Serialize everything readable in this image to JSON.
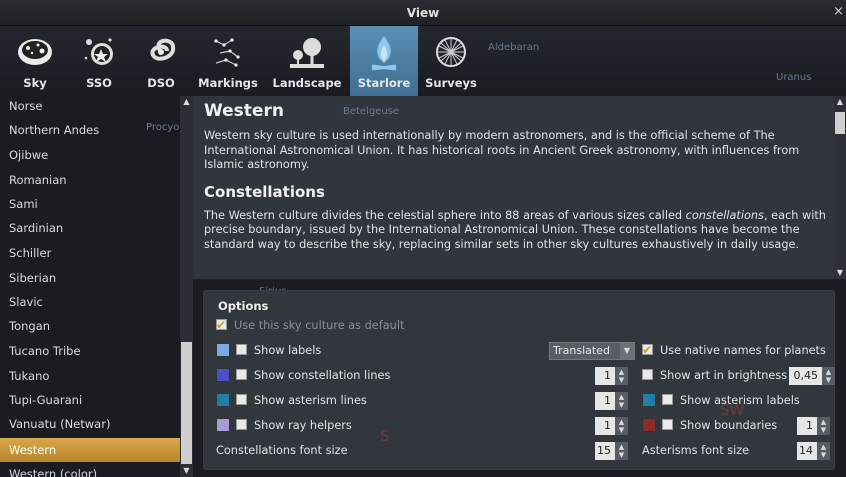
{
  "window": {
    "title": "View",
    "close": "×"
  },
  "toolbar": {
    "tabs": [
      {
        "label": "Sky",
        "icon": "sky-icon"
      },
      {
        "label": "SSO",
        "icon": "sso-icon"
      },
      {
        "label": "DSO",
        "icon": "dso-icon"
      },
      {
        "label": "Markings",
        "icon": "markings-icon"
      },
      {
        "label": "Landscape",
        "icon": "landscape-icon"
      },
      {
        "label": "Starlore",
        "icon": "starlore-icon",
        "active": true
      },
      {
        "label": "Surveys",
        "icon": "surveys-icon"
      }
    ],
    "active_color": "#4f83a8"
  },
  "sky_labels": {
    "aldebaran": "Aldebaran",
    "betelgeuse": "Betelgeuse",
    "procyon": "Procyon",
    "uranus": "Uranus",
    "sirius": "Sirius",
    "south": "S",
    "sw": "SW"
  },
  "sidebar": {
    "items": [
      "Norse",
      "Northern Andes",
      "Ojibwe",
      "Romanian",
      "Sami",
      "Sardinian",
      "Schiller",
      "Siberian",
      "Slavic",
      "Tongan",
      "Tucano Tribe",
      "Tukano",
      "Tupi-Guarani",
      "Vanuatu (Netwar)",
      "Western",
      "Western (color)"
    ],
    "selected": "Western",
    "selected_color": "#c99639"
  },
  "description": {
    "heading": "Western",
    "intro": "Western sky culture is used internationally by modern astronomers, and is the official scheme of The International Astronomical Union. It has historical roots in Ancient Greek astronomy, with influences from Islamic astronomy.",
    "subheading": "Constellations",
    "body_before": "The Western culture divides the celestial sphere into 88 areas of various sizes called ",
    "body_em": "constellations",
    "body_after": ", each with precise boundary, issued by the International Astronomical Union. These constellations have become the standard way to describe the sky, replacing similar sets in other sky cultures exhaustively in daily usage."
  },
  "options": {
    "title": "Options",
    "use_default": {
      "label": "Use this sky culture as default",
      "checked": true
    },
    "show_labels": {
      "label": "Show labels",
      "color": "#7aa9e6"
    },
    "labels_combo": "Translated",
    "native_names": {
      "label": "Use native names for planets",
      "checked": true
    },
    "constellation_lines": {
      "label": "Show constellation lines",
      "color": "#4b4fc8",
      "spin": "1"
    },
    "art_brightness": {
      "label": "Show art in brightness",
      "spin": "0,45"
    },
    "asterism_lines": {
      "label": "Show asterism lines",
      "color": "#1e7fa8",
      "spin": "1"
    },
    "asterism_labels": {
      "label": "Show asterism labels",
      "color": "#1e7fa8"
    },
    "ray_helpers": {
      "label": "Show ray helpers",
      "color": "#a99ad8",
      "spin": "1"
    },
    "boundaries": {
      "label": "Show boundaries",
      "color": "#8a2a2a",
      "spin": "1"
    },
    "const_font": {
      "label": "Constellations font size",
      "spin": "15"
    },
    "ast_font": {
      "label": "Asterisms font size",
      "spin": "14"
    }
  }
}
